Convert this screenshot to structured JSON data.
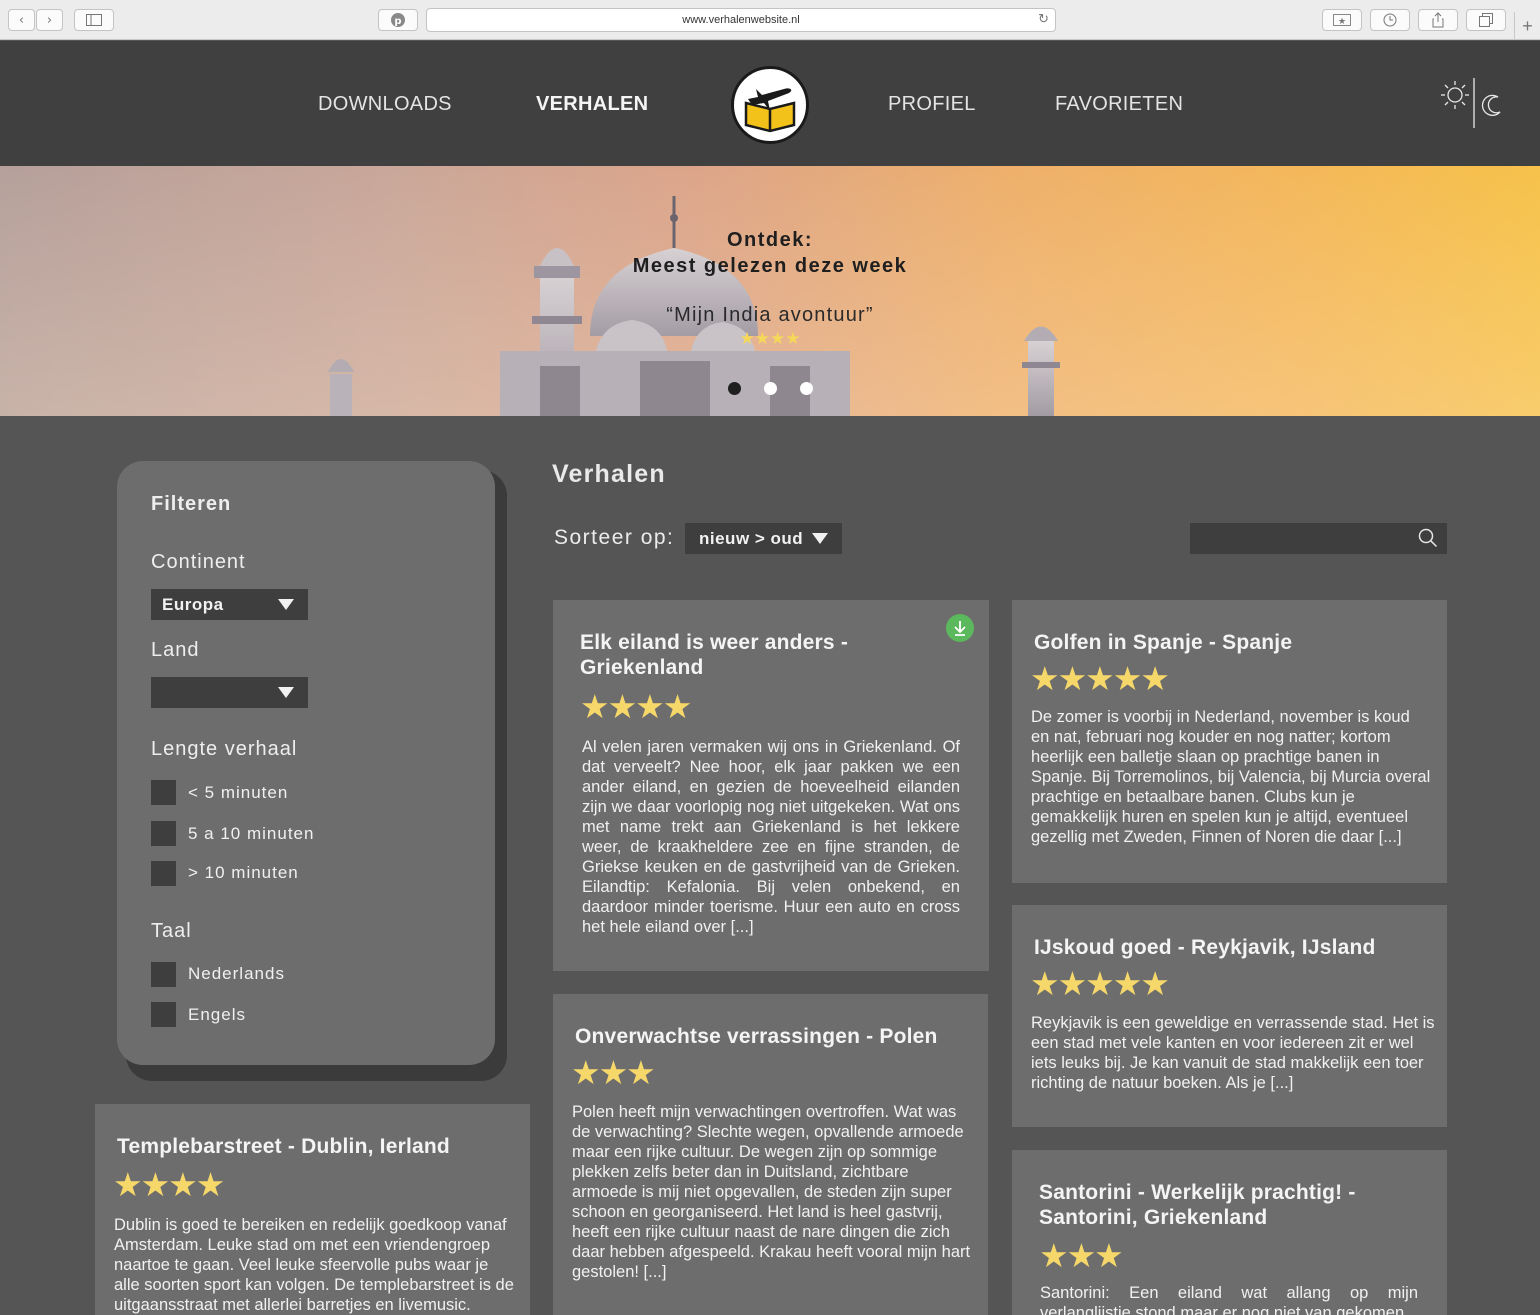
{
  "browser": {
    "url": "www.verhalenwebsite.nl"
  },
  "nav": {
    "downloads": "DOWNLOADS",
    "verhalen": "VERHALEN",
    "profiel": "PROFIEL",
    "favorieten": "FAVORIETEN",
    "active": "VERHALEN"
  },
  "hero": {
    "kicker": "Ontdek:",
    "title": "Meest gelezen deze week",
    "story": "“Mijn India avontuur”",
    "stars": "★★★★",
    "rating": 4,
    "slides": 3,
    "active_slide": 1
  },
  "filter": {
    "title": "Filteren",
    "continent_label": "Continent",
    "continent_value": "Europa",
    "land_label": "Land",
    "land_value": "",
    "length_label": "Lengte verhaal",
    "length_options": [
      "< 5 minuten",
      "5 a 10 minuten",
      "> 10 minuten"
    ],
    "language_label": "Taal",
    "language_options": [
      "Nederlands",
      "Engels"
    ]
  },
  "main": {
    "title": "Verhalen",
    "sort_label": "Sorteer op:",
    "sort_value": "nieuw > oud",
    "search_placeholder": ""
  },
  "stories": [
    {
      "title": "Elk eiland is weer anders - Griekenland",
      "rating": 4,
      "stars": "★★★★",
      "downloaded": true,
      "text": "Al velen jaren vermaken wij ons in Griekenland. Of dat verveelt? Nee hoor, elk jaar pakken we een ander eiland, en gezien de hoeveelheid eilanden zijn we daar voorlopig nog niet uitgekeken. Wat ons met name trekt aan Griekenland is het lekkere weer, de kraakheldere zee en fijne stranden, de Griekse keuken en de gastvrijheid van de Grieken. Eilandtip: Kefalonia. Bij velen onbekend, en daardoor minder toerisme. Huur een auto en cross het hele eiland over [...]"
    },
    {
      "title": "Golfen in Spanje - Spanje",
      "rating": 5,
      "stars": "★★★★★",
      "text": "De zomer is voorbij in Nederland, november is koud en nat, februari nog kouder en nog natter; kortom heerlijk een balletje slaan op prachtige banen in Spanje. Bij Torremolinos, bij Valencia, bij Murcia overal prachtige en betaalbare banen. Clubs kun je gemakkelijk huren en spelen kun je altijd, eventueel gezellig met Zweden, Finnen of Noren die daar [...]"
    },
    {
      "title": "IJskoud goed - Reykjavik, IJsland",
      "rating": 5,
      "stars": "★★★★★",
      "text": "Reykjavik is een geweldige en verrassende stad. Het is een stad met vele kanten en voor iedereen zit er wel iets leuks bij. Je kan vanuit de stad makkelijk een toer richting de natuur boeken. Als je [...]"
    },
    {
      "title": "Onverwachtse verrassingen - Polen",
      "rating": 3,
      "stars": "★★★",
      "text": "Polen heeft mijn verwachtingen overtroffen. Wat was de verwachting? Slechte wegen, opvallende armoede maar een rijke cultuur. De wegen zijn op sommige plekken zelfs beter dan in Duitsland, zichtbare armoede is mij niet opgevallen, de steden zijn super schoon en georganiseerd. Het land is heel gastvrij, heeft een rijke cultuur naast de nare dingen die zich daar hebben afgespeeld. Krakau heeft vooral mijn hart gestolen! [...]"
    },
    {
      "title": "Templebarstreet - Dublin, Ierland",
      "rating": 4,
      "stars": "★★★★",
      "text": "Dublin is goed te bereiken en redelijk goedkoop vanaf Amsterdam. Leuke stad om met een vriendengroep naartoe te gaan. Veel leuke sfeervolle pubs waar je alle soorten sport kan volgen. De templebarstreet is de uitgaansstraat met allerlei barretjes en livemusic."
    },
    {
      "title": "Santorini - Werkelijk prachtig! - Santorini, Griekenland",
      "rating": 3,
      "stars": "★★★",
      "text": "Santorini: Een eiland wat allang op mijn verlanglijstje stond maar er nog niet van gekomen"
    }
  ]
}
